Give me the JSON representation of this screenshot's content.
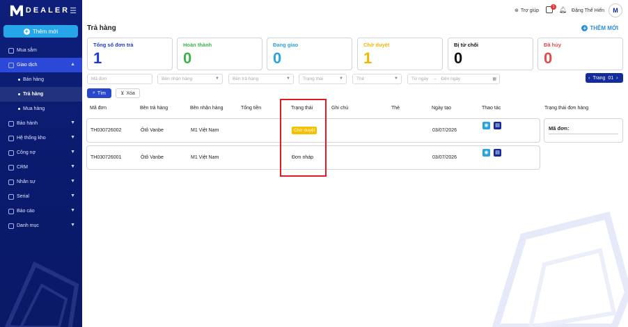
{
  "brand": {
    "name": "DEALER"
  },
  "sidebar": {
    "add_button": "Thêm mới",
    "items": [
      {
        "label": "Mua sắm"
      },
      {
        "label": "Giao dịch"
      },
      {
        "label": "Bán hàng"
      },
      {
        "label": "Trả hàng"
      },
      {
        "label": "Mua hàng"
      },
      {
        "label": "Bảo hành"
      },
      {
        "label": "Hệ thống kho"
      },
      {
        "label": "Công nợ"
      },
      {
        "label": "CRM"
      },
      {
        "label": "Nhân sự"
      },
      {
        "label": "Serial"
      },
      {
        "label": "Báo cáo"
      },
      {
        "label": "Danh mục"
      }
    ]
  },
  "header": {
    "help": "Trợ giúp",
    "cart_badge": "1",
    "user_name": "Đặng Thế Hiển",
    "avatar_initial": "M"
  },
  "page": {
    "title": "Trả hàng",
    "add_new": "THÊM MỚI"
  },
  "stats": [
    {
      "label": "Tổng số đơn trả",
      "value": "1",
      "color": "#1a3bd1"
    },
    {
      "label": "Hoàn thành",
      "value": "0",
      "color": "#3bb54a"
    },
    {
      "label": "Đang giao",
      "value": "0",
      "color": "#29a3df"
    },
    {
      "label": "Chờ duyệt",
      "value": "1",
      "color": "#f2b600"
    },
    {
      "label": "Bị từ chối",
      "value": "0",
      "color": "#111111"
    },
    {
      "label": "Đã hủy",
      "value": "0",
      "color": "#e04b4b"
    }
  ],
  "filters": {
    "order_code": "Mã đơn",
    "receiver": "Bên nhận hàng",
    "returner": "Bên trả hàng",
    "status": "Trạng thái",
    "tag": "Thẻ",
    "from_date": "Từ ngày",
    "to_date": "Đến ngày",
    "pager_label": "Trang",
    "pager_value": "01",
    "search_button": "Tìm",
    "clear_button": "Xóa"
  },
  "table": {
    "headers": {
      "code": "Mã đơn",
      "returner": "Bên trả hàng",
      "receiver": "Bên nhận hàng",
      "total": "Tổng tiền",
      "status": "Trạng thái",
      "note": "Ghi chú",
      "tag": "Thẻ",
      "created": "Ngày tạo",
      "actions": "Thao tác"
    },
    "rows": [
      {
        "code": "TH030726002",
        "returner": "Ôtô Vanbe",
        "receiver": "M1 Việt Nam",
        "status": "Chờ duyệt",
        "created": "03/07/2026"
      },
      {
        "code": "TH030726001",
        "returner": "Ôtô Vanbe",
        "receiver": "M1 Việt Nam",
        "status": "Đơn nháp",
        "created": "03/07/2026"
      }
    ]
  },
  "side_panel": {
    "title": "Trạng thái đơn hàng",
    "label": "Mã đơn:"
  },
  "colors": {
    "sidebar_bg": "#0d1f7a",
    "active_nav": "#2c48d8",
    "primary": "#2948c9",
    "accent": "#26a6e8",
    "highlight_border": "#e01b24",
    "pending_badge": "#f6c000"
  }
}
